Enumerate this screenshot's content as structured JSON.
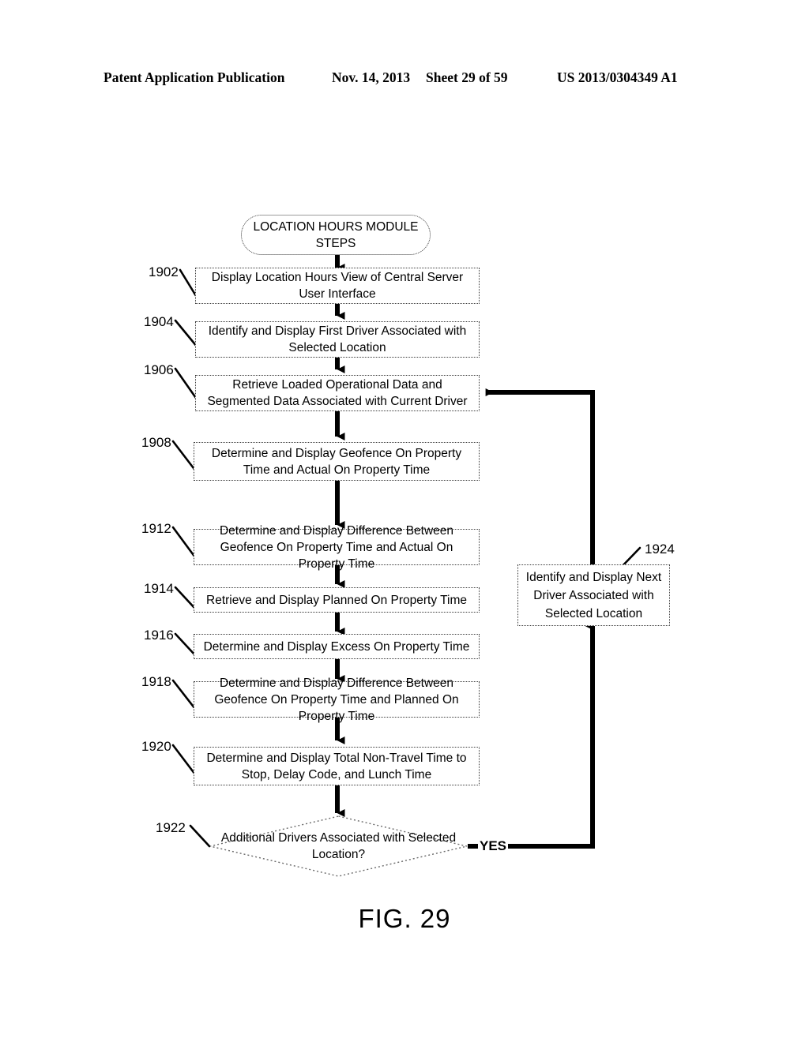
{
  "header": {
    "publication": "Patent Application Publication",
    "date": "Nov. 14, 2013",
    "sheet": "Sheet 29 of 59",
    "patent_number": "US 2013/0304349 A1"
  },
  "figure": {
    "caption": "FIG. 29",
    "type": "flowchart"
  },
  "flowchart": {
    "start": {
      "shape": "terminal",
      "label": "LOCATION HOURS MODULE STEPS"
    },
    "steps": [
      {
        "ref": "1902",
        "shape": "process",
        "label": "Display Location Hours View of Central Server User Interface"
      },
      {
        "ref": "1904",
        "shape": "process",
        "label": "Identify and Display First Driver Associated with Selected Location"
      },
      {
        "ref": "1906",
        "shape": "process",
        "label": "Retrieve Loaded Operational Data and Segmented Data Associated with Current Driver"
      },
      {
        "ref": "1908",
        "shape": "process",
        "label": "Determine and Display Geofence On Property Time and Actual On Property Time"
      },
      {
        "ref": "1912",
        "shape": "process",
        "label": "Determine and Display Difference Between Geofence On Property Time and Actual On Property Time"
      },
      {
        "ref": "1914",
        "shape": "process",
        "label": "Retrieve and Display Planned On Property Time"
      },
      {
        "ref": "1916",
        "shape": "process",
        "label": "Determine and Display Excess On Property Time"
      },
      {
        "ref": "1918",
        "shape": "process",
        "label": "Determine and Display Difference Between Geofence On Property Time and Planned On Property Time"
      },
      {
        "ref": "1920",
        "shape": "process",
        "label": "Determine and Display Total Non-Travel Time to Stop, Delay Code, and Lunch Time"
      },
      {
        "ref": "1922",
        "shape": "decision",
        "label": "Additional Drivers Associated with Selected Location?"
      },
      {
        "ref": "1924",
        "shape": "process",
        "label": "Identify and Display Next Driver Associated with Selected Location"
      }
    ],
    "edges": [
      {
        "from": "start",
        "to": "1902",
        "label": ""
      },
      {
        "from": "1902",
        "to": "1904",
        "label": ""
      },
      {
        "from": "1904",
        "to": "1906",
        "label": ""
      },
      {
        "from": "1906",
        "to": "1908",
        "label": ""
      },
      {
        "from": "1908",
        "to": "1912",
        "label": ""
      },
      {
        "from": "1912",
        "to": "1914",
        "label": ""
      },
      {
        "from": "1914",
        "to": "1916",
        "label": ""
      },
      {
        "from": "1916",
        "to": "1918",
        "label": ""
      },
      {
        "from": "1918",
        "to": "1920",
        "label": ""
      },
      {
        "from": "1920",
        "to": "1922",
        "label": ""
      },
      {
        "from": "1922",
        "to": "1924",
        "label": "YES"
      },
      {
        "from": "1924",
        "to": "1906",
        "label": ""
      }
    ],
    "yes_label": "YES"
  }
}
